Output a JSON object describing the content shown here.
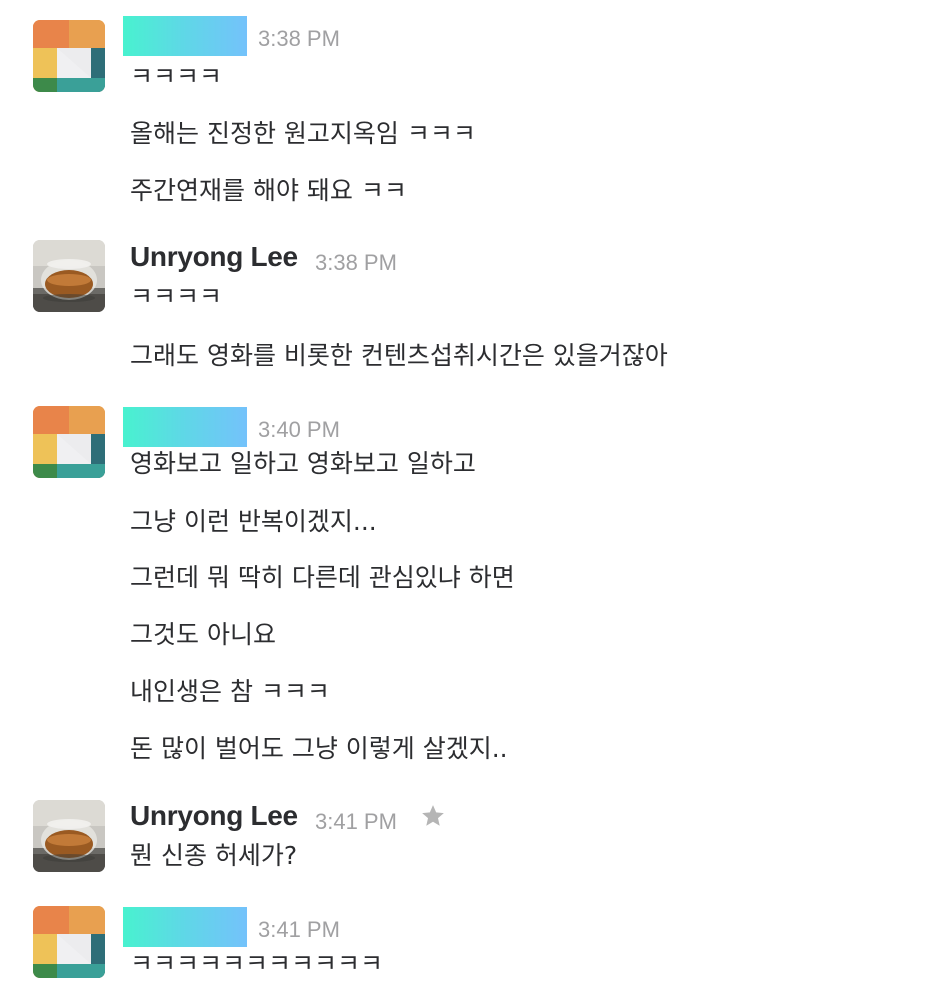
{
  "messages": [
    {
      "user": "",
      "time": "3:38 PM",
      "lines": [
        "ㅋㅋㅋㅋ",
        "올해는 진정한 원고지옥임 ㅋㅋㅋ",
        "주간연재를 해야 돼요 ㅋㅋ"
      ]
    },
    {
      "user": "Unryong Lee",
      "time": "3:38 PM",
      "lines": [
        "ㅋㅋㅋㅋ",
        "그래도 영화를 비롯한 컨텐츠섭취시간은 있을거잖아"
      ]
    },
    {
      "user": "",
      "time": "3:40 PM",
      "lines": [
        "영화보고 일하고 영화보고 일하고",
        "그냥 이런 반복이겠지...",
        "그런데 뭐 딱히 다른데 관심있냐 하면",
        "그것도 아니요",
        "내인생은 참 ㅋㅋㅋ",
        "돈 많이 벌어도 그냥 이렇게 살겠지.."
      ]
    },
    {
      "user": "Unryong Lee",
      "time": "3:41 PM",
      "starred": true,
      "lines": [
        "뭔 신종 허세가?"
      ]
    },
    {
      "user": "",
      "time": "3:41 PM",
      "lines": [
        "ㅋㅋㅋㅋㅋㅋㅋㅋㅋㅋㅋ"
      ]
    }
  ],
  "colors": {
    "name_mask_start": "#48f2cf",
    "name_mask_end": "#74c2fb",
    "timestamp": "#a0a0a2",
    "text": "#2c2d30",
    "star": "#b5b5b5"
  },
  "icons": {
    "star": "star-icon",
    "avatar_tiles": "identicon-avatar",
    "avatar_photo": "teacup-photo-avatar"
  }
}
